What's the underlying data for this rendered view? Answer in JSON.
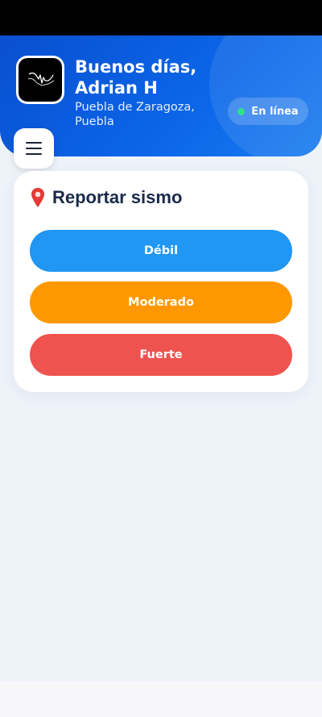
{
  "header": {
    "greeting": "Buenos días, Adrian H",
    "location": "Puebla de Zaragoza, Puebla",
    "status_label": "En línea",
    "status_color": "#2ee38a",
    "logo_icon": "seismograph-logo"
  },
  "menu": {
    "icon": "hamburger-menu-icon"
  },
  "report_card": {
    "icon": "red-pin-icon",
    "title": "Reportar sismo",
    "buttons": [
      {
        "label": "Débil",
        "color": "#2196f3"
      },
      {
        "label": "Moderado",
        "color": "#ff9800"
      },
      {
        "label": "Fuerte",
        "color": "#ef5350"
      }
    ]
  }
}
